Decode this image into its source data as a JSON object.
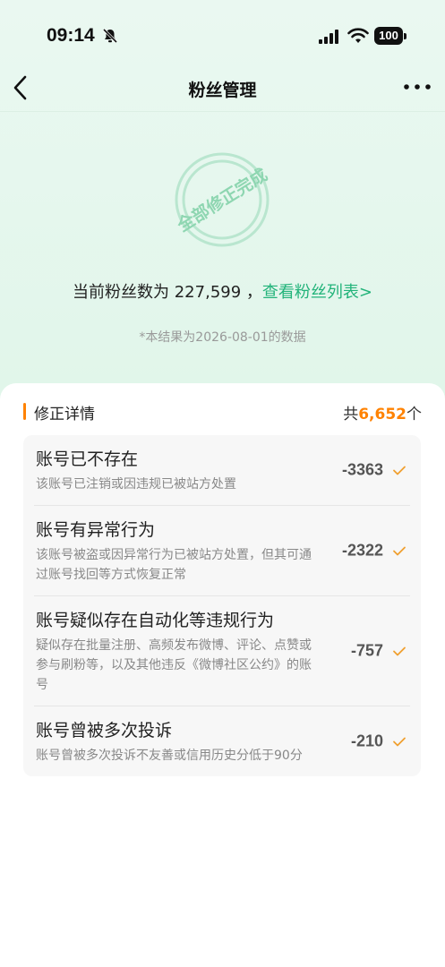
{
  "status_bar": {
    "time": "09:14",
    "battery": "100"
  },
  "nav": {
    "title": "粉丝管理"
  },
  "stamp": {
    "text": "全部修正完成"
  },
  "summary": {
    "prefix": "当前粉丝数为 ",
    "count": "227,599",
    "separator": " ，",
    "link": "查看粉丝列表>",
    "date_note": "*本结果为2026-08-01的数据"
  },
  "details": {
    "title": "修正详情",
    "total_prefix": "共",
    "total_count": "6,652",
    "total_suffix": "个",
    "items": [
      {
        "title": "账号已不存在",
        "desc": "该账号已注销或因违规已被站方处置",
        "value": "-3363"
      },
      {
        "title": "账号有异常行为",
        "desc": "该账号被盗或因异常行为已被站方处置，但其可通过账号找回等方式恢复正常",
        "value": "-2322"
      },
      {
        "title": "账号疑似存在自动化等违规行为",
        "desc": "疑似存在批量注册、高频发布微博、评论、点赞或参与刷粉等，以及其他违反《微博社区公约》的账号",
        "value": "-757"
      },
      {
        "title": "账号曾被多次投诉",
        "desc": "账号曾被多次投诉不友善或信用历史分低于90分",
        "value": "-210"
      }
    ]
  },
  "colors": {
    "accent": "#ff8200",
    "brand_green": "#22b37a"
  }
}
